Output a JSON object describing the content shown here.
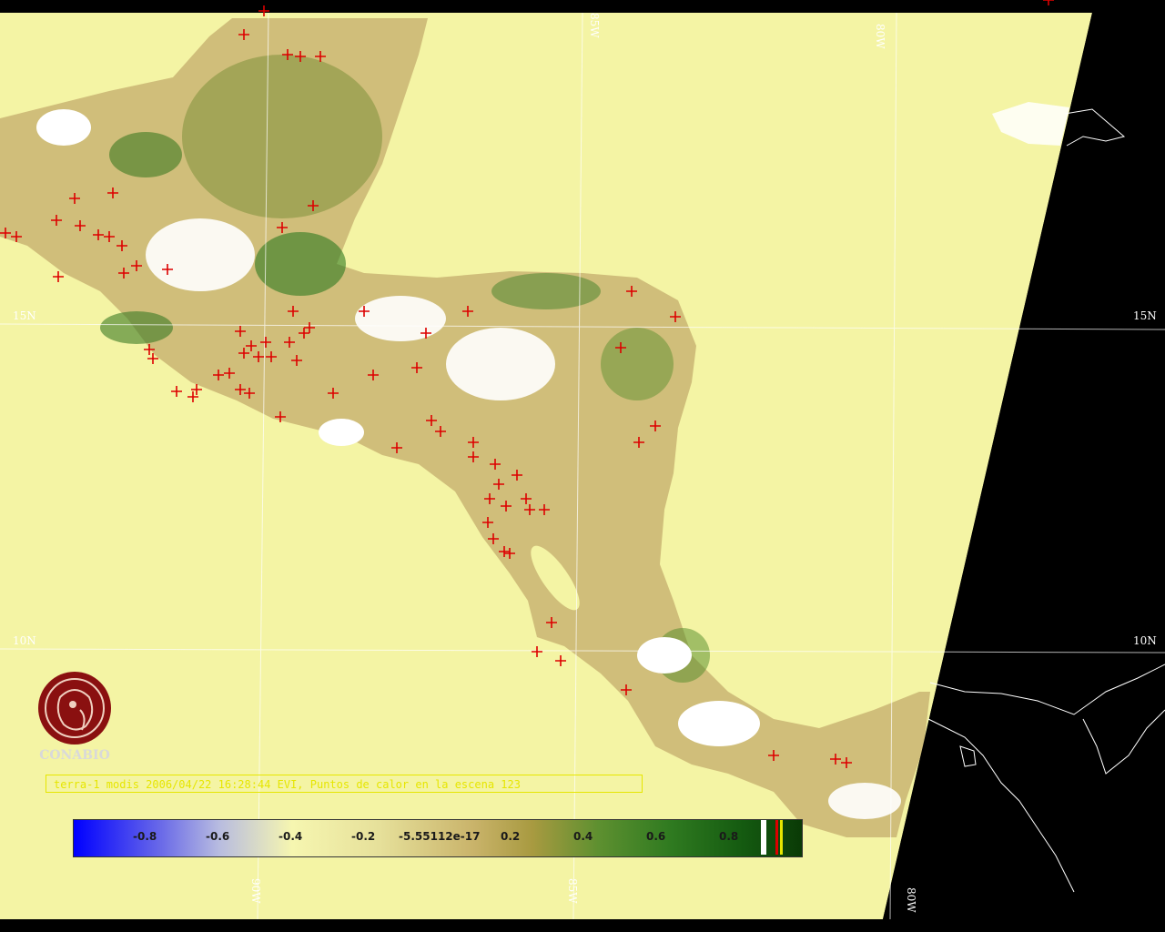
{
  "map": {
    "grid_labels": {
      "lat_15_left": "15N",
      "lat_15_right": "15N",
      "lat_10_left": "10N",
      "lat_10_right": "10N",
      "lon_85_top": "85W",
      "lon_80_top": "80W",
      "lon_90_bottom": "90W",
      "lon_85_bottom": "85W",
      "lon_80_bottom": "80W"
    },
    "colors": {
      "ocean": "#f4f4a4",
      "outside_swath": "#000000",
      "fire_marker": "#dd0000",
      "vegetation_dark": "#2f7a20",
      "vegetation_light": "#c9b36a",
      "cloud": "#ffffff"
    }
  },
  "caption": "terra-1 modis 2006/04/22 16:28:44 EVI, Puntos de calor en la escena 123",
  "colorbar": {
    "ticks": [
      "-0.8",
      "-0.6",
      "-0.4",
      "-0.2",
      "-5.55112e-17",
      "0.2",
      "0.4",
      "0.6",
      "0.8"
    ]
  },
  "logo": {
    "text": "CONABIO"
  }
}
